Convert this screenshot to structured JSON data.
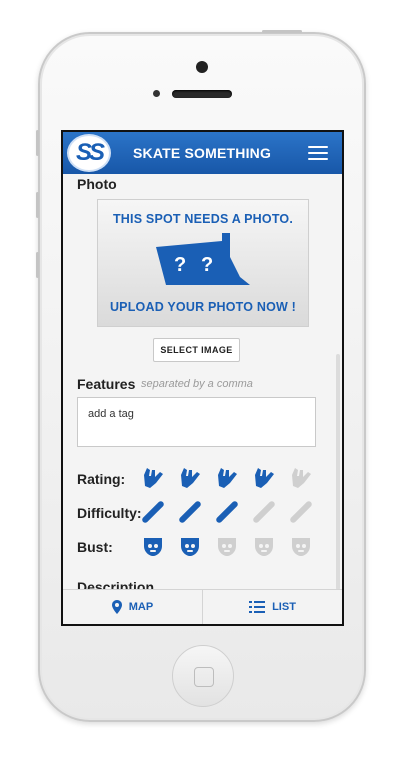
{
  "app": {
    "title": "SKATE SOMETHING",
    "logo_text": "SS"
  },
  "photo": {
    "label": "Photo",
    "placeholder_line1": "THIS SPOT NEEDS A PHOTO.",
    "placeholder_line2": "UPLOAD YOUR PHOTO NOW !",
    "select_button": "SELECT IMAGE"
  },
  "features": {
    "label": "Features",
    "hint": "separated by a comma",
    "input_value": "add a tag"
  },
  "ratings": {
    "rating_label": "Rating:",
    "rating_value": 4,
    "difficulty_label": "Difficulty:",
    "difficulty_value": 3,
    "bust_label": "Bust:",
    "bust_value": 2,
    "max": 5
  },
  "description": {
    "label": "Description"
  },
  "nav": {
    "map_label": "MAP",
    "list_label": "LIST"
  },
  "colors": {
    "brand_blue": "#1a5fb5",
    "inactive_gray": "#cfcfcf"
  }
}
